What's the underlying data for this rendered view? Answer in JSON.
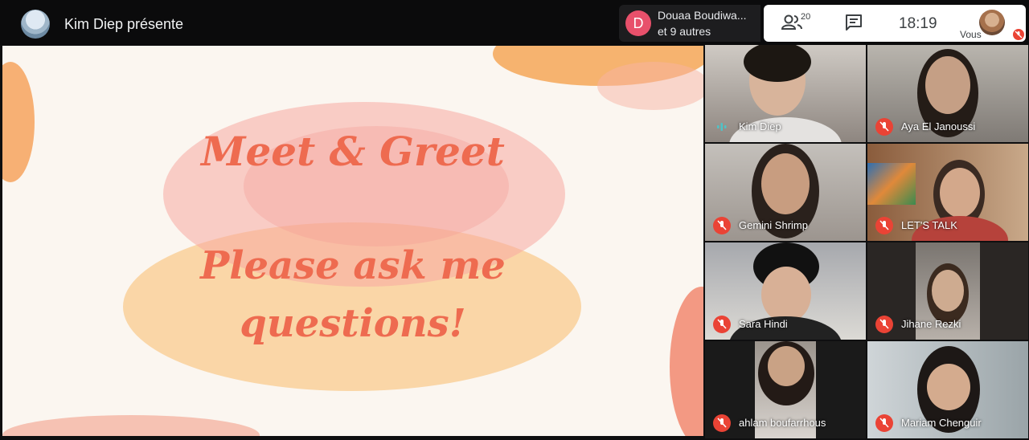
{
  "header": {
    "presenter_text": "Kim Diep présente",
    "dock_avatar_letter": "D",
    "dock_name": "Douaa Boudiwa...",
    "dock_more": "et 9 autres",
    "people_count": "20",
    "time": "18:19",
    "self_label": "Vous"
  },
  "slide": {
    "title": "Meet & Greet",
    "subtitle_line1": "Please ask me",
    "subtitle_line2": "questions!"
  },
  "participants": [
    {
      "name": "Kim Diep",
      "muted": false
    },
    {
      "name": "Aya El Janoussi",
      "muted": true
    },
    {
      "name": "Gemini Shrimp",
      "muted": true
    },
    {
      "name": "LET'S TALK",
      "muted": true
    },
    {
      "name": "Sara Hindi",
      "muted": true
    },
    {
      "name": "Jihane Rezki",
      "muted": true
    },
    {
      "name": "ahlam boufarrhous",
      "muted": true
    },
    {
      "name": "Mariam Chenguir",
      "muted": true
    }
  ],
  "colors": {
    "accent": "#ee6b50",
    "mute_red": "#ea4335",
    "speaking_teal": "#4fc3c7"
  }
}
